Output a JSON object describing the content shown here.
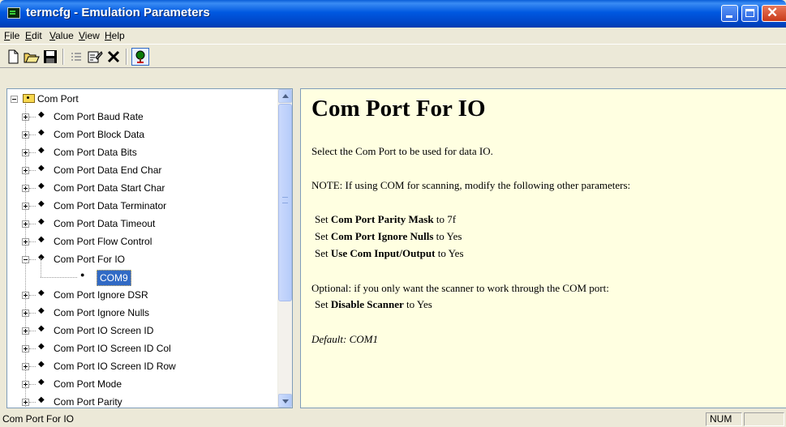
{
  "window": {
    "title": "termcfg - Emulation Parameters"
  },
  "menu": [
    {
      "acc": "F",
      "rest": "ile"
    },
    {
      "acc": "E",
      "rest": "dit"
    },
    {
      "acc": "V",
      "rest": "alue"
    },
    {
      "acc": "V",
      "rest": "iew"
    },
    {
      "acc": "H",
      "rest": "elp"
    }
  ],
  "toolbar": {
    "icons": [
      "new-document-icon",
      "open-folder-icon",
      "save-disk-icon",
      "list-icon",
      "properties-icon",
      "delete-x-icon",
      "tree-view-icon"
    ]
  },
  "tree": {
    "root": "Com Port",
    "items": [
      "Com Port Baud Rate",
      "Com Port Block Data",
      "Com Port Data Bits",
      "Com Port Data End Char",
      "Com Port Data Start Char",
      "Com Port Data Terminator",
      "Com Port Data Timeout",
      "Com Port Flow Control",
      "Com Port For IO",
      "Com Port Ignore DSR",
      "Com Port Ignore Nulls",
      "Com Port IO Screen ID",
      "Com Port IO Screen ID Col",
      "Com Port IO Screen ID Row",
      "Com Port Mode",
      "Com Port Parity"
    ],
    "selected_value": "COM9"
  },
  "content": {
    "heading": "Com Port For IO",
    "line1": "Select the Com Port to be used for data IO.",
    "note": "NOTE:  If using COM for scanning, modify the following other parameters:",
    "settings": [
      {
        "pre": "Set ",
        "bold": "Com Port Parity Mask",
        "post": " to 7f"
      },
      {
        "pre": "Set ",
        "bold": "Com Port Ignore Nulls",
        "post": " to Yes"
      },
      {
        "pre": "Set ",
        "bold": "Use Com Input/Output",
        "post": " to Yes"
      }
    ],
    "optional": "Optional: if you only want the scanner to work through the COM port:",
    "optional_setting": {
      "pre": "Set ",
      "bold": "Disable Scanner",
      "post": " to Yes"
    },
    "default": "Default: COM1"
  },
  "status": {
    "text": "Com Port For IO",
    "num": "NUM"
  }
}
